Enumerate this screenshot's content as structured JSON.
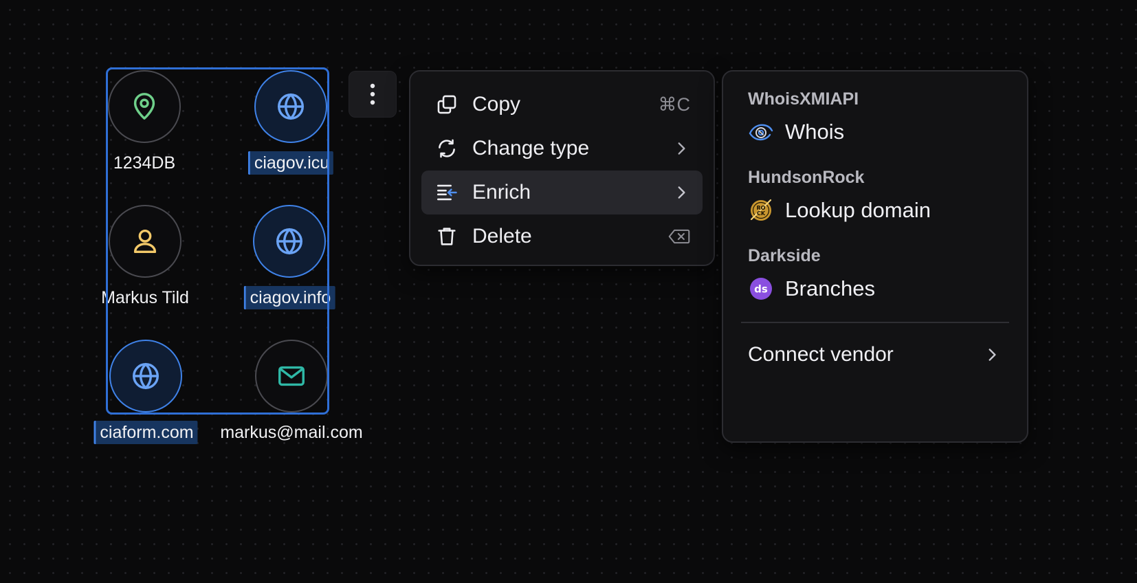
{
  "nodes": [
    {
      "label": "1234DB",
      "icon": "map-pin-icon",
      "selected": false,
      "icon_color": "#6fd08a"
    },
    {
      "label": "ciagov.icu",
      "icon": "globe-icon",
      "selected": true,
      "icon_color": "#6aa3f5"
    },
    {
      "label": "Markus Tild",
      "icon": "user-icon",
      "selected": false,
      "icon_color": "#f3c969"
    },
    {
      "label": "ciagov.info",
      "icon": "globe-icon",
      "selected": true,
      "icon_color": "#6aa3f5"
    },
    {
      "label": "ciaform.com",
      "icon": "globe-icon",
      "selected": true,
      "icon_color": "#6aa3f5"
    },
    {
      "label": "markus@mail.com",
      "icon": "mail-icon",
      "selected": false,
      "icon_color": "#2fb8a6"
    }
  ],
  "more_button": {
    "icon": "more-vertical-icon"
  },
  "context_menu": {
    "items": [
      {
        "label": "Copy",
        "icon": "copy-icon",
        "shortcut": "⌘C",
        "has_submenu": false
      },
      {
        "label": "Change type",
        "icon": "refresh-icon",
        "shortcut": "",
        "has_submenu": true
      },
      {
        "label": "Enrich",
        "icon": "enrich-icon",
        "shortcut": "",
        "has_submenu": true,
        "active": true
      },
      {
        "label": "Delete",
        "icon": "trash-icon",
        "shortcut": "⌫",
        "has_submenu": false
      }
    ]
  },
  "vendor_menu": {
    "groups": [
      {
        "vendor": "WhoisXMIAPI",
        "action": "Whois",
        "icon": "whois-logo-icon"
      },
      {
        "vendor": "HundsonRock",
        "action": "Lookup domain",
        "icon": "hudsonrock-logo-icon"
      },
      {
        "vendor": "Darkside",
        "action": "Branches",
        "icon": "darkside-logo-icon"
      }
    ],
    "connect_label": "Connect vendor"
  },
  "colors": {
    "selection": "#2f6fd6",
    "background": "#0a0a0b",
    "menu_bg": "#121214",
    "active_item": "#27272c"
  }
}
